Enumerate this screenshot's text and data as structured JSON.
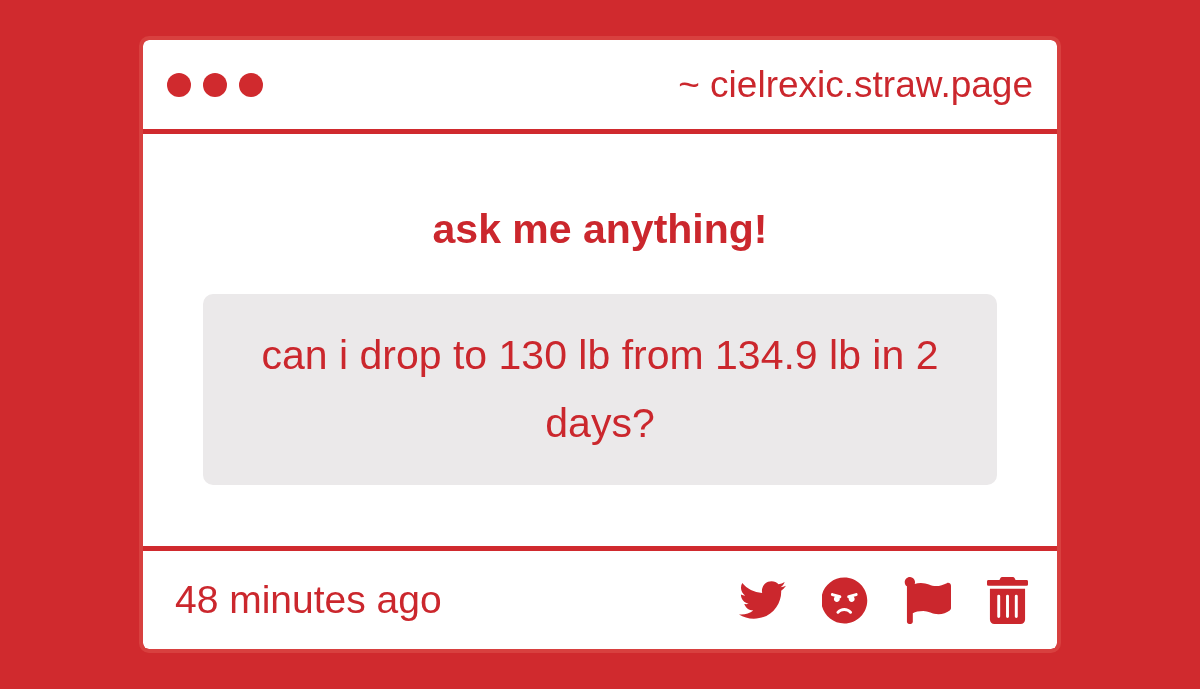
{
  "window": {
    "address": "~ cielrexic.straw.page"
  },
  "heading": "ask me anything!",
  "question": {
    "text": "can i drop to 130 lb from 134.9 lb in 2 days?"
  },
  "footer": {
    "time": "48 minutes ago"
  }
}
